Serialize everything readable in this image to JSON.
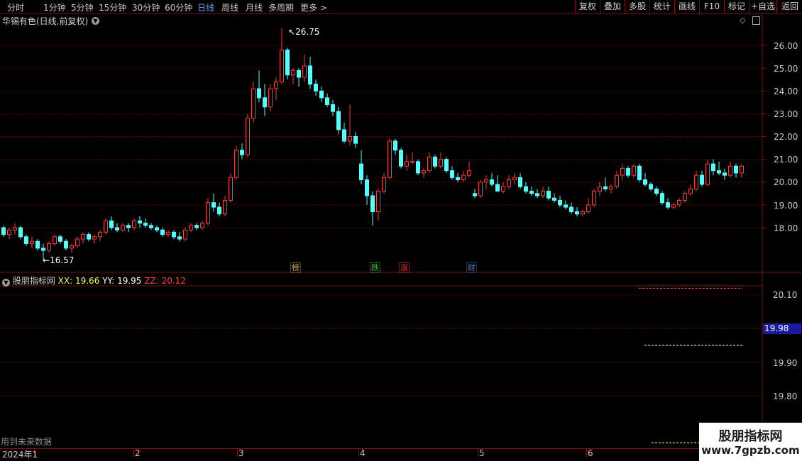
{
  "toolbar": {
    "periods": [
      "分时",
      "1分钟",
      "5分钟",
      "15分钟",
      "30分钟",
      "60分钟",
      "日线",
      "周线",
      "月线",
      "多周期",
      "更多"
    ],
    "active_period": "日线",
    "right_buttons": [
      "复权",
      "叠加",
      "多股",
      "统计",
      "画线",
      "F10",
      "标记",
      "+自选",
      "返回"
    ]
  },
  "main_chart": {
    "title": "华锡有色(日线,前复权)",
    "high_label": "26.75",
    "low_label": "16.57",
    "y_labels": [
      "26.00",
      "25.00",
      "24.00",
      "23.00",
      "22.00",
      "21.00",
      "20.00",
      "19.00",
      "18.00"
    ],
    "events": [
      {
        "label": "榜",
        "color": "#e0b030"
      },
      {
        "label": "跌",
        "color": "#30c030"
      },
      {
        "label": "涨",
        "color": "#e03030"
      },
      {
        "label": "财",
        "color": "#4a80ff"
      }
    ]
  },
  "indicator": {
    "name": "股朋指标网",
    "xx_label": "XX: 19.66",
    "yy_label": "YY: 19.95",
    "zz_label": "ZZ: 20.12",
    "y_labels": [
      "20.10",
      "20.00",
      "19.90",
      "19.80"
    ],
    "current_value": "19.98",
    "future_note": "用到未来数据"
  },
  "xaxis": {
    "labels": [
      "2024年1",
      "2",
      "3",
      "4",
      "5",
      "6"
    ]
  },
  "watermark": {
    "title": "股朋指标网",
    "url": "www.7gpzb.com"
  },
  "colors": {
    "up": "#ff3b3b",
    "down": "#54ffff",
    "grid": "#7a1010",
    "xx": "#ffff4a",
    "yy": "#ffffff",
    "zz": "#ff4040"
  },
  "chart_data": {
    "type": "candlestick",
    "title": "华锡有色(日线,前复权)",
    "ylim": [
      17.0,
      26.8
    ],
    "x_ticks": [
      "2024年1",
      "2",
      "3",
      "4",
      "5",
      "6"
    ],
    "candles": [
      [
        18.0,
        18.1,
        17.6,
        17.7
      ],
      [
        17.7,
        18.0,
        17.5,
        17.9
      ],
      [
        17.9,
        18.2,
        17.7,
        18.0
      ],
      [
        18.0,
        18.1,
        17.5,
        17.6
      ],
      [
        17.6,
        17.7,
        17.2,
        17.3
      ],
      [
        17.3,
        17.6,
        17.1,
        17.4
      ],
      [
        17.4,
        17.5,
        17.0,
        17.1
      ],
      [
        17.1,
        17.3,
        16.6,
        17.0
      ],
      [
        17.0,
        17.4,
        16.9,
        17.3
      ],
      [
        17.3,
        17.7,
        17.2,
        17.6
      ],
      [
        17.6,
        17.7,
        17.3,
        17.4
      ],
      [
        17.4,
        17.5,
        17.0,
        17.1
      ],
      [
        17.1,
        17.3,
        16.9,
        17.2
      ],
      [
        17.2,
        17.6,
        17.1,
        17.5
      ],
      [
        17.5,
        17.8,
        17.3,
        17.7
      ],
      [
        17.7,
        17.8,
        17.4,
        17.5
      ],
      [
        17.5,
        17.7,
        17.3,
        17.6
      ],
      [
        17.6,
        17.9,
        17.4,
        17.8
      ],
      [
        17.8,
        18.4,
        17.7,
        18.3
      ],
      [
        18.3,
        18.5,
        17.9,
        18.0
      ],
      [
        18.0,
        18.2,
        17.8,
        17.9
      ],
      [
        17.9,
        18.2,
        17.8,
        18.1
      ],
      [
        18.1,
        18.2,
        17.8,
        18.0
      ],
      [
        18.0,
        18.4,
        17.9,
        18.3
      ],
      [
        18.3,
        18.5,
        18.0,
        18.2
      ],
      [
        18.2,
        18.4,
        18.0,
        18.1
      ],
      [
        18.1,
        18.2,
        17.9,
        18.0
      ],
      [
        18.0,
        18.1,
        17.8,
        17.9
      ],
      [
        17.9,
        18.0,
        17.6,
        17.7
      ],
      [
        17.7,
        17.9,
        17.6,
        17.8
      ],
      [
        17.8,
        17.9,
        17.5,
        17.6
      ],
      [
        17.6,
        17.8,
        17.4,
        17.5
      ],
      [
        17.5,
        18.0,
        17.4,
        17.9
      ],
      [
        17.9,
        18.2,
        17.8,
        18.1
      ],
      [
        18.1,
        18.2,
        17.9,
        18.0
      ],
      [
        18.0,
        18.3,
        17.9,
        18.2
      ],
      [
        18.2,
        19.3,
        18.1,
        19.1
      ],
      [
        19.1,
        19.5,
        18.7,
        18.9
      ],
      [
        18.9,
        19.1,
        18.5,
        18.6
      ],
      [
        18.6,
        19.4,
        18.5,
        19.2
      ],
      [
        19.2,
        20.4,
        19.1,
        20.2
      ],
      [
        20.2,
        21.6,
        20.1,
        21.4
      ],
      [
        21.4,
        21.7,
        21.0,
        21.2
      ],
      [
        21.2,
        23.0,
        21.1,
        22.8
      ],
      [
        22.8,
        24.4,
        22.6,
        24.1
      ],
      [
        24.1,
        24.9,
        23.5,
        23.7
      ],
      [
        23.7,
        24.3,
        22.9,
        23.3
      ],
      [
        23.3,
        24.3,
        23.1,
        24.1
      ],
      [
        24.1,
        24.6,
        23.6,
        24.4
      ],
      [
        24.4,
        26.75,
        24.3,
        25.8
      ],
      [
        25.8,
        25.9,
        24.5,
        24.7
      ],
      [
        24.7,
        25.0,
        24.3,
        24.9
      ],
      [
        24.9,
        25.0,
        24.2,
        24.6
      ],
      [
        24.6,
        25.6,
        24.4,
        25.1
      ],
      [
        25.1,
        25.5,
        24.1,
        24.3
      ],
      [
        24.3,
        24.5,
        23.8,
        24.0
      ],
      [
        24.0,
        24.2,
        23.5,
        23.7
      ],
      [
        23.7,
        23.9,
        23.3,
        23.4
      ],
      [
        23.4,
        23.6,
        22.9,
        23.1
      ],
      [
        23.1,
        23.3,
        22.1,
        22.3
      ],
      [
        22.3,
        22.6,
        21.7,
        21.8
      ],
      [
        21.8,
        23.4,
        21.6,
        22.0
      ],
      [
        22.0,
        22.2,
        21.5,
        21.7
      ],
      [
        20.8,
        21.4,
        19.9,
        20.1
      ],
      [
        20.1,
        20.3,
        19.0,
        19.4
      ],
      [
        19.4,
        19.6,
        18.1,
        18.7
      ],
      [
        18.7,
        19.7,
        18.3,
        19.6
      ],
      [
        19.6,
        20.4,
        19.5,
        20.2
      ],
      [
        20.2,
        21.9,
        20.1,
        21.8
      ],
      [
        21.8,
        21.9,
        21.2,
        21.4
      ],
      [
        21.4,
        21.5,
        20.6,
        20.7
      ],
      [
        20.7,
        21.2,
        20.5,
        20.9
      ],
      [
        20.9,
        21.3,
        20.8,
        20.9
      ],
      [
        20.9,
        21.0,
        20.3,
        20.4
      ],
      [
        20.4,
        20.6,
        20.2,
        20.5
      ],
      [
        20.5,
        21.3,
        20.4,
        21.1
      ],
      [
        21.1,
        21.2,
        20.6,
        20.7
      ],
      [
        20.7,
        21.3,
        20.6,
        21.0
      ],
      [
        21.0,
        21.1,
        20.4,
        20.5
      ],
      [
        20.5,
        20.7,
        20.1,
        20.2
      ],
      [
        20.2,
        20.4,
        20.0,
        20.1
      ],
      [
        20.1,
        20.5,
        20.0,
        20.3
      ],
      [
        20.3,
        20.9,
        20.2,
        20.5
      ],
      [
        19.5,
        19.7,
        19.3,
        19.4
      ],
      [
        19.4,
        20.1,
        19.3,
        20.0
      ],
      [
        20.0,
        20.3,
        19.7,
        20.1
      ],
      [
        20.1,
        20.4,
        19.8,
        19.9
      ],
      [
        19.9,
        20.3,
        19.7,
        19.6
      ],
      [
        19.6,
        20.0,
        19.5,
        19.8
      ],
      [
        19.8,
        20.3,
        19.7,
        20.1
      ],
      [
        20.1,
        20.4,
        19.9,
        20.2
      ],
      [
        20.2,
        20.4,
        19.7,
        19.8
      ],
      [
        19.8,
        20.0,
        19.5,
        19.6
      ],
      [
        19.6,
        19.8,
        19.4,
        19.5
      ],
      [
        19.5,
        19.7,
        19.3,
        19.4
      ],
      [
        19.4,
        19.8,
        19.3,
        19.6
      ],
      [
        19.6,
        19.8,
        19.2,
        19.3
      ],
      [
        19.3,
        19.5,
        19.1,
        19.2
      ],
      [
        19.2,
        19.4,
        18.9,
        19.0
      ],
      [
        19.0,
        19.2,
        18.8,
        18.9
      ],
      [
        18.9,
        19.1,
        18.6,
        18.7
      ],
      [
        18.7,
        18.9,
        18.5,
        18.6
      ],
      [
        18.6,
        18.8,
        18.5,
        18.7
      ],
      [
        18.7,
        19.3,
        18.6,
        19.0
      ],
      [
        19.0,
        19.7,
        18.9,
        19.6
      ],
      [
        19.6,
        20.0,
        19.4,
        19.8
      ],
      [
        19.8,
        20.2,
        19.6,
        19.7
      ],
      [
        19.7,
        19.9,
        19.5,
        19.8
      ],
      [
        19.8,
        20.5,
        19.7,
        20.3
      ],
      [
        20.3,
        20.8,
        20.1,
        20.6
      ],
      [
        20.6,
        20.7,
        20.2,
        20.3
      ],
      [
        20.3,
        20.8,
        20.2,
        20.7
      ],
      [
        20.7,
        20.8,
        20.0,
        20.1
      ],
      [
        20.1,
        20.4,
        19.8,
        19.9
      ],
      [
        19.9,
        20.0,
        19.6,
        19.7
      ],
      [
        19.7,
        19.8,
        19.4,
        19.5
      ],
      [
        19.5,
        19.6,
        19.0,
        19.1
      ],
      [
        19.1,
        19.3,
        18.8,
        18.9
      ],
      [
        18.9,
        19.1,
        18.8,
        19.0
      ],
      [
        19.0,
        19.3,
        18.9,
        19.2
      ],
      [
        19.2,
        19.6,
        19.1,
        19.5
      ],
      [
        19.5,
        19.9,
        19.4,
        19.7
      ],
      [
        19.7,
        20.5,
        19.6,
        20.3
      ],
      [
        20.3,
        20.5,
        19.8,
        19.9
      ],
      [
        19.9,
        21.0,
        19.8,
        20.8
      ],
      [
        20.8,
        21.0,
        20.3,
        20.5
      ],
      [
        20.5,
        20.9,
        20.3,
        20.4
      ],
      [
        20.4,
        20.6,
        20.1,
        20.3
      ],
      [
        20.3,
        20.9,
        20.2,
        20.7
      ],
      [
        20.7,
        20.8,
        20.2,
        20.4
      ],
      [
        20.4,
        20.8,
        20.2,
        20.7
      ]
    ],
    "indicator_lines": {
      "XX": 19.66,
      "YY": 19.95,
      "ZZ": 20.12
    }
  }
}
